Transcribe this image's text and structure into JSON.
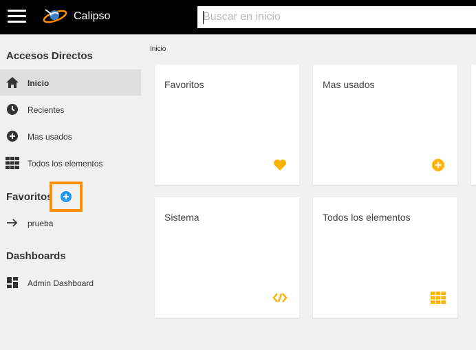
{
  "header": {
    "app_title": "Calipso",
    "search_placeholder": "Buscar en inicio"
  },
  "sidebar": {
    "shortcuts_title": "Accesos Directos",
    "shortcuts": [
      {
        "label": "Inicio",
        "icon": "home-icon",
        "active": true
      },
      {
        "label": "Recientes",
        "icon": "clock-icon",
        "active": false
      },
      {
        "label": "Mas usados",
        "icon": "plus-circle-icon",
        "active": false
      },
      {
        "label": "Todos los elementos",
        "icon": "grid-icon",
        "active": false
      }
    ],
    "favorites_title": "Favoritos",
    "favorites": [
      {
        "label": "prueba",
        "icon": "arrow-right-icon"
      }
    ],
    "dashboards_title": "Dashboards",
    "dashboards": [
      {
        "label": "Admin Dashboard",
        "icon": "dashboard-icon"
      }
    ]
  },
  "breadcrumb": "Inicio",
  "cards": [
    {
      "title": "Favoritos",
      "icon": "heart-icon"
    },
    {
      "title": "Mas usados",
      "icon": "plus-circle-icon"
    },
    {
      "title": "Sistema",
      "icon": "code-icon"
    },
    {
      "title": "Todos los elementos",
      "icon": "grid-icon"
    }
  ],
  "colors": {
    "topbar": "#000000",
    "accent_icon": "#ffb300",
    "highlight": "#ff8f00",
    "add_button": "#2196f3",
    "active_item": "#dedede"
  }
}
